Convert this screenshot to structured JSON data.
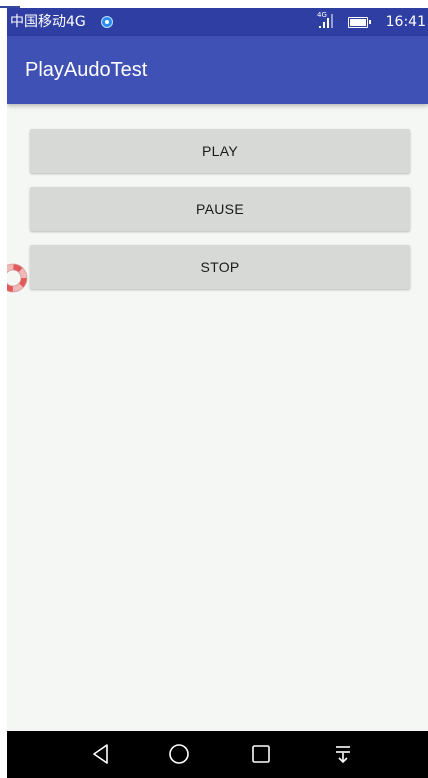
{
  "status_bar": {
    "carrier": "中国移动4G",
    "network_type": "4G",
    "time": "16:41"
  },
  "app_bar": {
    "title": "PlayAudoTest"
  },
  "buttons": {
    "play": "PLAY",
    "pause": "PAUSE",
    "stop": "STOP"
  },
  "nav_bar": {
    "icons": [
      "back-icon",
      "home-icon",
      "recents-icon",
      "notification-pull-icon"
    ]
  },
  "colors": {
    "status_bar": "#2f3ea3",
    "app_bar": "#3f51b5",
    "content_bg": "#f4f7f4",
    "button_bg": "#d7d9d7",
    "nav_bar": "#000000"
  }
}
